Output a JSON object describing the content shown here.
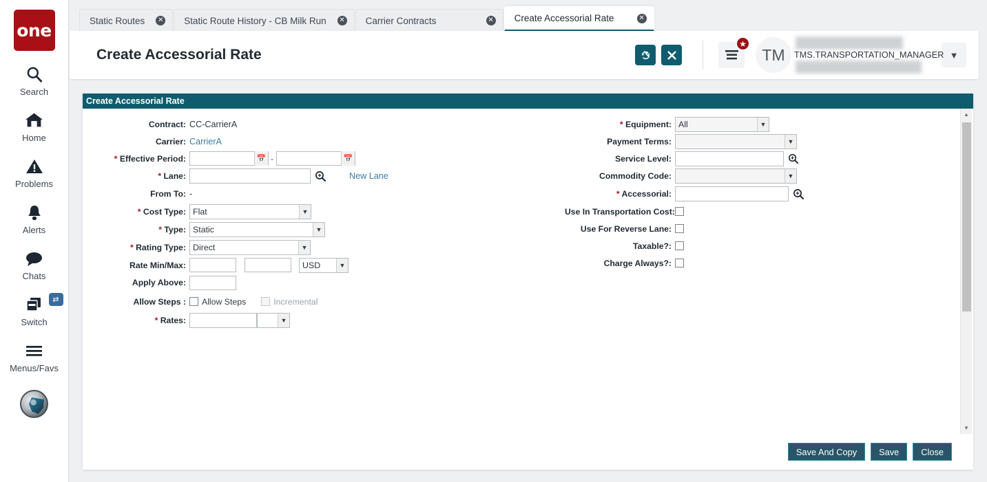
{
  "sidebar": {
    "brand_label": "one",
    "items": [
      {
        "label": "Search",
        "icon": "search-icon"
      },
      {
        "label": "Home",
        "icon": "home-icon"
      },
      {
        "label": "Problems",
        "icon": "warning-triangle-icon"
      },
      {
        "label": "Alerts",
        "icon": "bell-icon"
      },
      {
        "label": "Chats",
        "icon": "chat-bubble-icon"
      },
      {
        "label": "Switch",
        "icon": "windows-stack-icon",
        "badge_icon": "swap-arrows-icon"
      },
      {
        "label": "Menus/Favs",
        "icon": "hamburger-icon"
      }
    ]
  },
  "tabs": [
    {
      "label": "Static Routes",
      "active": false
    },
    {
      "label": "Static Route History - CB Milk Run",
      "active": false
    },
    {
      "label": "Carrier Contracts",
      "active": false
    },
    {
      "label": "Create Accessorial Rate",
      "active": true
    }
  ],
  "header": {
    "title": "Create Accessorial Rate",
    "refresh_icon": "refresh-icon",
    "close_icon": "close-x-icon",
    "menu_icon": "hamburger-menu-icon",
    "menu_badge_icon": "star-icon",
    "avatar_initials": "TM",
    "user_name": "TMS.TRANSPORTATION_MANAGER",
    "caret_icon": "chevron-down-icon"
  },
  "panel": {
    "title": "Create Accessorial Rate",
    "left_fields": {
      "contract_label": "Contract:",
      "contract_value": "CC-CarrierA",
      "carrier_label": "Carrier:",
      "carrier_value": "CarrierA",
      "effective_period_label": "Effective Period:",
      "effective_period_start": "",
      "effective_period_end": "",
      "effective_period_separator": "-",
      "lane_label": "Lane:",
      "lane_value": "",
      "new_lane_link": "New Lane",
      "from_to_label": "From To:",
      "from_to_value": "-",
      "cost_type_label": "Cost Type:",
      "cost_type_value": "Flat",
      "type_label": "Type:",
      "type_value": "Static",
      "rating_type_label": "Rating Type:",
      "rating_type_value": "Direct",
      "rate_min_max_label": "Rate Min/Max:",
      "rate_min_value": "",
      "rate_max_value": "",
      "currency_value": "USD",
      "apply_above_label": "Apply Above:",
      "apply_above_value": "",
      "allow_steps_label": "Allow Steps :",
      "allow_steps_checkbox_label": "Allow Steps",
      "incremental_checkbox_label": "Incremental",
      "rates_label": "Rates:",
      "rates_value": "",
      "rates_unit_value": ""
    },
    "right_fields": {
      "equipment_label": "Equipment:",
      "equipment_value": "All",
      "payment_terms_label": "Payment Terms:",
      "payment_terms_value": "",
      "service_level_label": "Service Level:",
      "service_level_value": "",
      "commodity_code_label": "Commodity Code:",
      "commodity_code_value": "",
      "accessorial_label": "Accessorial:",
      "accessorial_value": "",
      "use_in_transportation_cost_label": "Use In Transportation Cost:",
      "use_for_reverse_lane_label": "Use For Reverse Lane:",
      "taxable_label": "Taxable?:",
      "charge_always_label": "Charge Always?:"
    },
    "footer": {
      "save_and_copy_label": "Save And Copy",
      "save_label": "Save",
      "close_label": "Close"
    }
  },
  "colors": {
    "brand_red": "#a81016",
    "teal": "#0f5c6e",
    "button_navy": "#2a5468",
    "link_blue": "#3b7ca6",
    "required_red": "#a3181e"
  }
}
